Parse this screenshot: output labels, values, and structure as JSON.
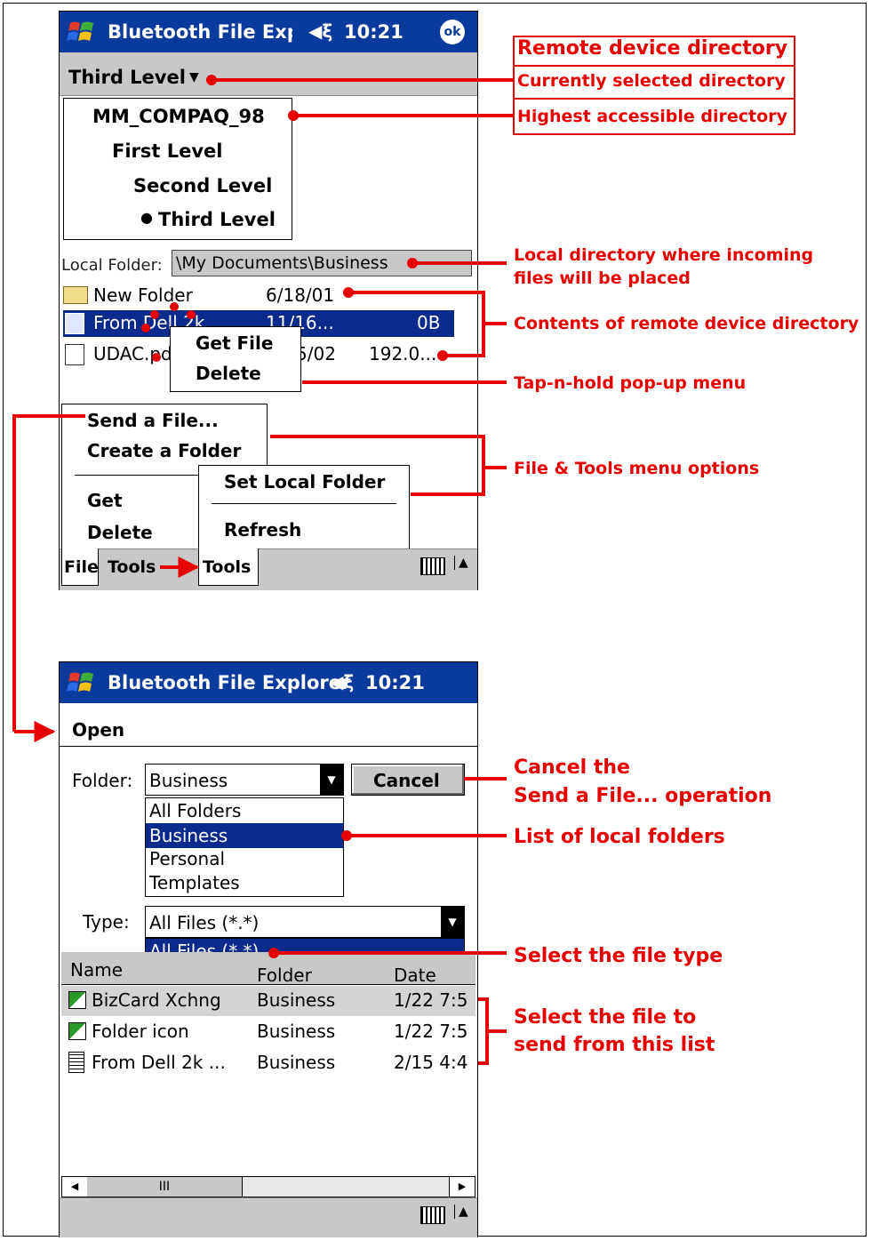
{
  "screen1": {
    "title": "Bluetooth File Explorer",
    "time": "10:21",
    "ok": "ok",
    "nav_dropdown": "Third Level",
    "tree": [
      "MM_COMPAQ_98",
      "First Level",
      "Second Level",
      "Third Level"
    ],
    "local_folder_label": "Local Folder:",
    "local_folder_value": "\\My Documents\\Business",
    "files": [
      {
        "name": "New Folder",
        "date": "6/18/01",
        "size": ""
      },
      {
        "name": "From Dell 2k",
        "date": "11/16...",
        "size": "0B"
      },
      {
        "name": "UDAC.pdf",
        "date": "5/02",
        "size": "192.0..."
      }
    ],
    "popup": [
      "Get File",
      "Delete"
    ],
    "file_menu": [
      "Send a File...",
      "Create a Folder",
      "Get",
      "Delete"
    ],
    "tools_menu": [
      "Set Local Folder",
      "Refresh"
    ],
    "bottom_tabs": [
      "File",
      "Tools",
      "Tools"
    ]
  },
  "screen2": {
    "title": "Bluetooth File Explorer",
    "time": "10:21",
    "command": "Open",
    "folder_label": "Folder:",
    "folder_value": "Business",
    "cancel": "Cancel",
    "folder_options": [
      "All Folders",
      "Business",
      "Personal",
      "Templates"
    ],
    "type_label": "Type:",
    "type_value": "All Files (*.*)",
    "type_options": [
      "All Files (*.*)"
    ],
    "columns": [
      "Name",
      "Folder",
      "Date"
    ],
    "rows": [
      {
        "name": "BizCard Xchng",
        "folder": "Business",
        "date": "1/22 7:5"
      },
      {
        "name": "Folder icon",
        "folder": "Business",
        "date": "1/22 7:5"
      },
      {
        "name": "From Dell 2k ...",
        "folder": "Business",
        "date": "2/15 4:4"
      }
    ],
    "scroll_mid": "III"
  },
  "annotations": {
    "remote_dir": "Remote device directory",
    "current_dir": "Currently selected directory",
    "highest_dir": "Highest accessible directory",
    "local_dir_1": "Local directory where incoming",
    "local_dir_2": "files will be placed",
    "contents": "Contents of remote device directory",
    "popup_menu": "Tap-n-hold pop-up menu",
    "file_tools": "File & Tools menu options",
    "cancel_1": "Cancel the",
    "cancel_2": "Send a File... operation",
    "list_folders": "List of local folders",
    "select_type": "Select the file type",
    "select_file_1": "Select the file to",
    "select_file_2": "send from this list"
  },
  "colors": {
    "accent": "#0a3a9c",
    "selection": "#0a2a8c",
    "annotation": "#e60000"
  }
}
